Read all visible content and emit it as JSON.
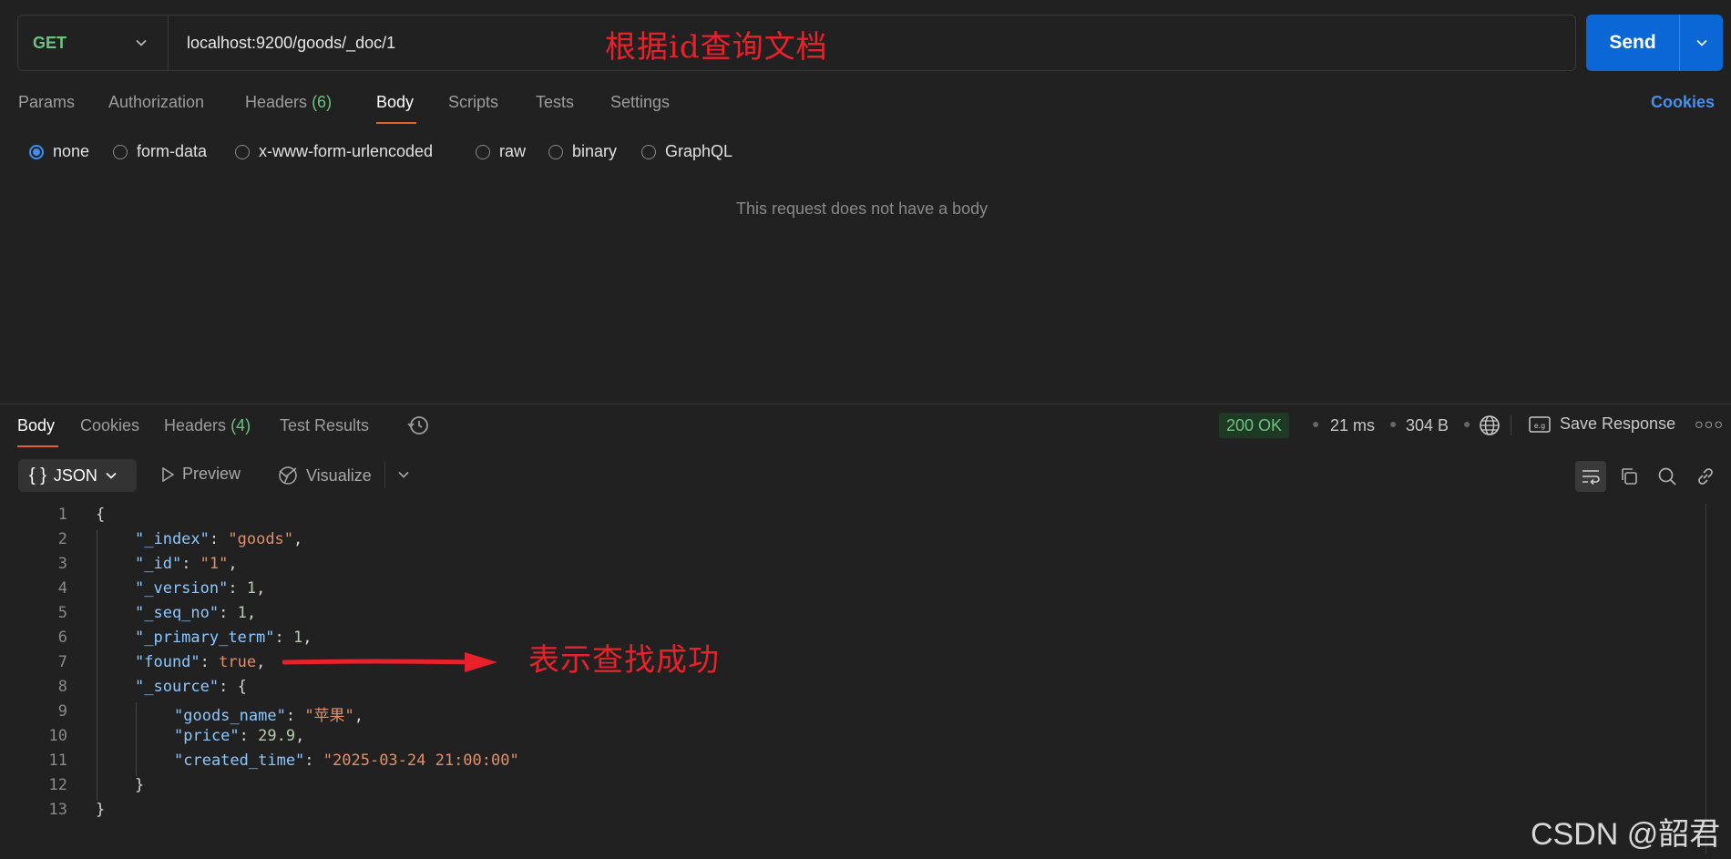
{
  "request": {
    "method": "GET",
    "url": "localhost:9200/goods/_doc/1",
    "annotation": "根据id查询文档",
    "send_label": "Send",
    "tabs": [
      {
        "label": "Params"
      },
      {
        "label": "Authorization"
      },
      {
        "label": "Headers",
        "count": "(6)"
      },
      {
        "label": "Body"
      },
      {
        "label": "Scripts"
      },
      {
        "label": "Tests"
      },
      {
        "label": "Settings"
      }
    ],
    "active_tab": "Body",
    "cookies_label": "Cookies",
    "body_types": [
      "none",
      "form-data",
      "x-www-form-urlencoded",
      "raw",
      "binary",
      "GraphQL"
    ],
    "selected_body_type": "none",
    "empty_message": "This request does not have a body"
  },
  "response": {
    "tabs": [
      {
        "label": "Body"
      },
      {
        "label": "Cookies"
      },
      {
        "label": "Headers",
        "count": "(4)"
      },
      {
        "label": "Test Results"
      }
    ],
    "active_tab": "Body",
    "status": "200 OK",
    "time": "21 ms",
    "size": "304 B",
    "save_label": "Save Response",
    "format": "JSON",
    "format_brace": "{ }",
    "preview_label": "Preview",
    "visualize_label": "Visualize",
    "annotation": "表示查找成功",
    "lines": [
      {
        "n": "1"
      },
      {
        "n": "2"
      },
      {
        "n": "3"
      },
      {
        "n": "4"
      },
      {
        "n": "5"
      },
      {
        "n": "6"
      },
      {
        "n": "7"
      },
      {
        "n": "8"
      },
      {
        "n": "9"
      },
      {
        "n": "10"
      },
      {
        "n": "11"
      },
      {
        "n": "12"
      },
      {
        "n": "13"
      }
    ],
    "json": {
      "open": "{",
      "index_key": "\"_index\"",
      "index_val": "\"goods\"",
      "id_key": "\"_id\"",
      "id_val": "\"1\"",
      "version_key": "\"_version\"",
      "version_val": "1",
      "seq_key": "\"_seq_no\"",
      "seq_val": "1",
      "term_key": "\"_primary_term\"",
      "term_val": "1",
      "found_key": "\"found\"",
      "found_val": "true",
      "source_key": "\"_source\"",
      "source_open": "{",
      "name_key": "\"goods_name\"",
      "name_val": "\"苹果\"",
      "price_key": "\"price\"",
      "price_val": "29.9",
      "created_key": "\"created_time\"",
      "created_val": "\"2025-03-24 21:00:00\"",
      "source_close": "}",
      "close": "}"
    }
  },
  "watermark": "CSDN @韶君",
  "colors": {
    "send": "#0b66d6",
    "accent": "#e0632a",
    "ok": "#6cc480",
    "annotation": "#e8222a"
  }
}
